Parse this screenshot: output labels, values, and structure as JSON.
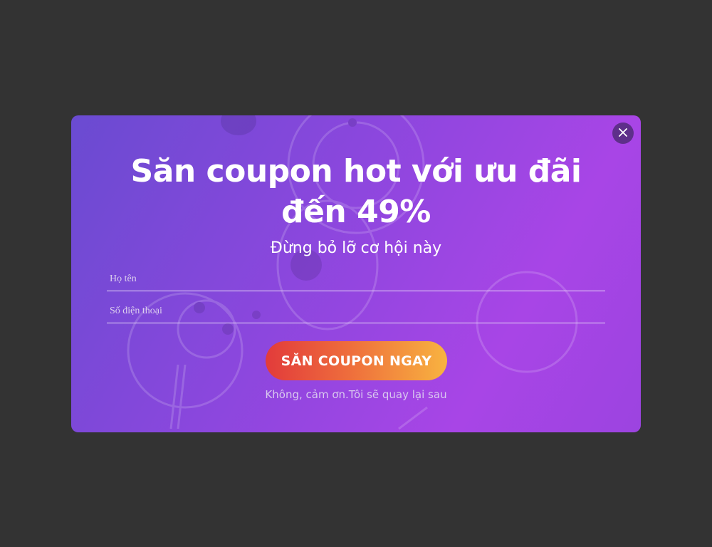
{
  "popup": {
    "title": "Săn coupon hot với ưu đãi đến 49%",
    "subtitle": "Đừng bỏ lỡ cơ hội này",
    "name_placeholder": "Họ tên",
    "phone_placeholder": "Số điện thoại",
    "cta_label": "SĂN COUPON NGAY",
    "decline_text": "Không, cảm ơn.Tôi sẽ quay lại sau",
    "close_icon": "close-icon"
  },
  "colors": {
    "overlay": "#333333",
    "gradient_start": "#6a4bd1",
    "gradient_end": "#a845e6",
    "cta_start": "#e23b3b",
    "cta_end": "#f8b340",
    "close_bg": "#5e2f8a"
  }
}
